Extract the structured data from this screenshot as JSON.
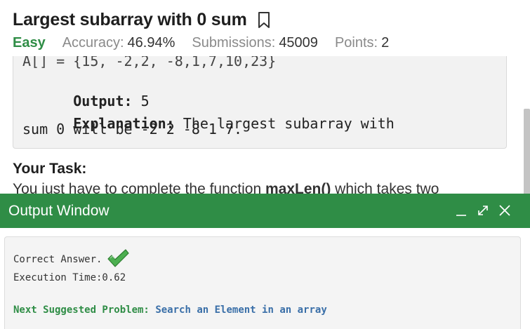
{
  "problem": {
    "title": "Largest subarray with 0 sum",
    "difficulty": "Easy",
    "accuracy_label": "Accuracy:",
    "accuracy_value": "46.94%",
    "submissions_label": "Submissions:",
    "submissions_value": "45009",
    "points_label": "Points:",
    "points_value": "2"
  },
  "example": {
    "cut_line": "A[] = {15, -2,2, -8,1,7,10,23}",
    "output_label": "Output:",
    "output_value": " 5",
    "explanation_label": "Explanation:",
    "explanation_text_1": " The largest subarray with",
    "explanation_text_2": "sum 0 will be -2 2 -8 1 7."
  },
  "task": {
    "heading": "Your Task:",
    "text_before": "You just have to complete the function ",
    "function_name": "maxLen()",
    "text_after": " which takes two"
  },
  "output_window": {
    "title": "Output Window",
    "result": "Correct Answer.",
    "execution_time": "Execution Time:0.62",
    "next_label": "Next Suggested Problem:",
    "next_problem": "Search an Element in an array"
  },
  "colors": {
    "brand_green": "#2f8d46",
    "link_blue": "#3a6fa8"
  },
  "icons": [
    "bookmark-icon",
    "minimize-icon",
    "expand-icon",
    "close-icon",
    "check-icon"
  ]
}
